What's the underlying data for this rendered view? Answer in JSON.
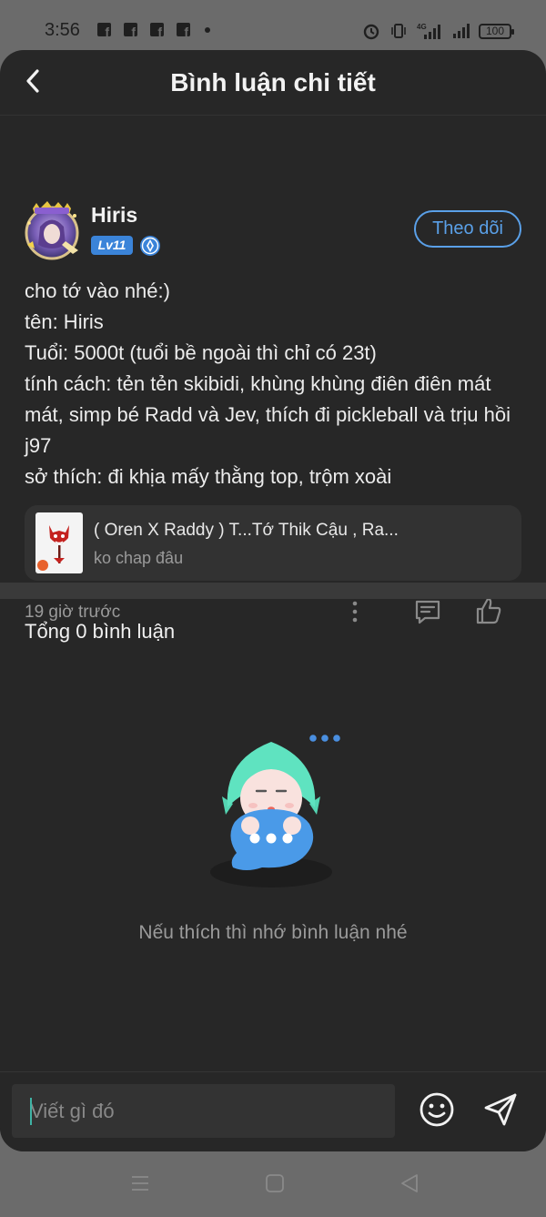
{
  "status_bar": {
    "time": "3:56",
    "battery": "100",
    "network": "4G"
  },
  "header": {
    "title": "Bình luận chi tiết"
  },
  "post": {
    "username": "Hiris",
    "level": "Lv11",
    "follow_label": "Theo dõi",
    "body_lines": [
      "cho tớ vào nhé:)",
      "tên: Hiris",
      "Tuổi: 5000t (tuổi bề ngoài thì chỉ có 23t)",
      "tính cách: tẻn tẻn skibidi, khùng khùng điên điên mát mát, simp bé Radd và Jev, thích đi pickleball và trịu hồi j97",
      "sở thích: đi khịa mấy thằng top, trộm xoài"
    ],
    "music": {
      "title": "( Oren X Raddy ) T...Tớ Thik Cậu , Ra...",
      "artist": "ko chap đâu"
    },
    "time": "19 giờ trước"
  },
  "comments": {
    "title": "Tổng 0 bình luận",
    "empty_text": "Nếu thích thì nhớ bình luận nhé"
  },
  "input": {
    "placeholder": "Viết gì đó"
  },
  "colors": {
    "accent": "#5aa0e8",
    "background": "#272727",
    "level_badge": "#3b84d9"
  }
}
